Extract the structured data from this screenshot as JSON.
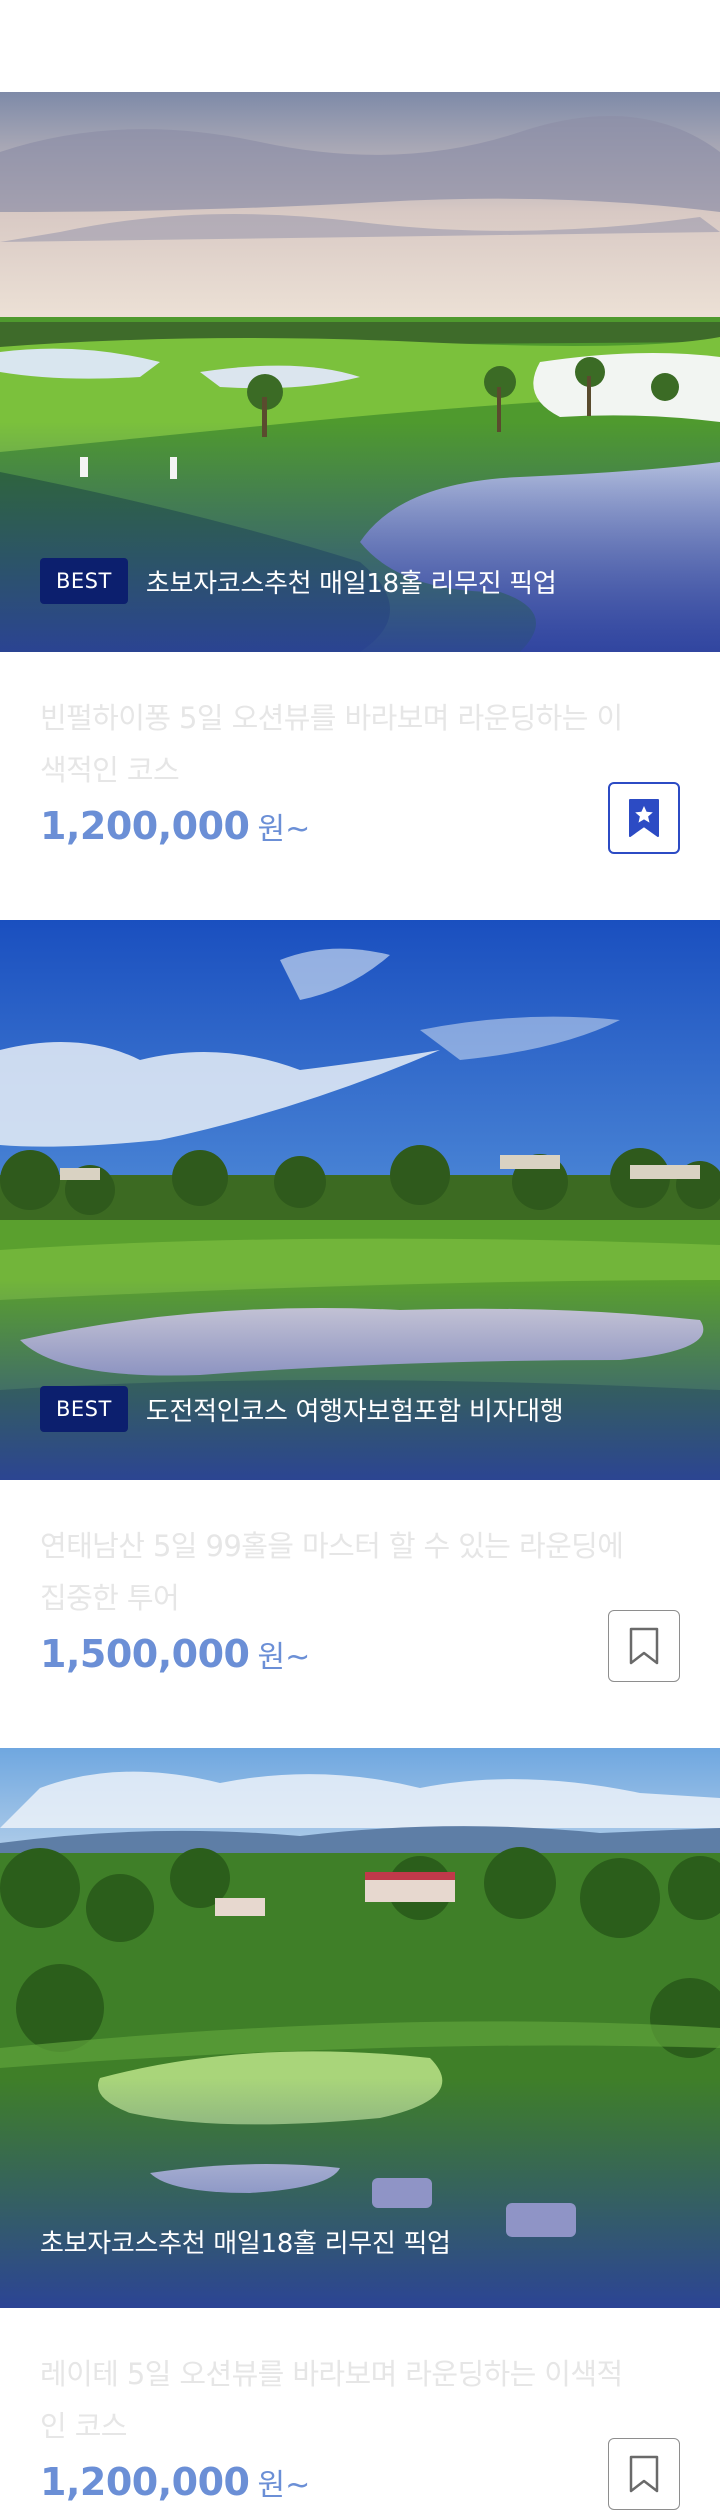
{
  "tours": [
    {
      "badge": "BEST",
      "caption": "초보자코스추천 매일18홀 리무진 픽업",
      "description": "빈펄하이퐁 5일 오션뷰를 바라보며 라운딩하는 이색적인 코스",
      "price": "1,200,000",
      "unit": "원~",
      "bookmarked": true,
      "bookmark_icon": "bookmark-star-icon"
    },
    {
      "badge": "BEST",
      "caption": "도전적인코스 여행자보험포함 비자대행",
      "description": "연태남산 5일 99홀을 마스터 할 수 있는 라운딩에 집중한 투어",
      "price": "1,500,000",
      "unit": "원~",
      "bookmarked": false,
      "bookmark_icon": "bookmark-icon"
    },
    {
      "badge": "",
      "caption": "초보자코스추천 매일18홀 리무진 픽업",
      "description": "레이테 5일 오션뷰를 바라보며 라운딩하는 이색적인 코스",
      "price": "1,200,000",
      "unit": "원~",
      "bookmarked": false,
      "bookmark_icon": "bookmark-icon"
    }
  ],
  "colors": {
    "badge_bg": "#0c1f6e",
    "price": "#6b8fd6",
    "bookmark_active": "#2c4bc4",
    "description": "#e6e6e6"
  }
}
